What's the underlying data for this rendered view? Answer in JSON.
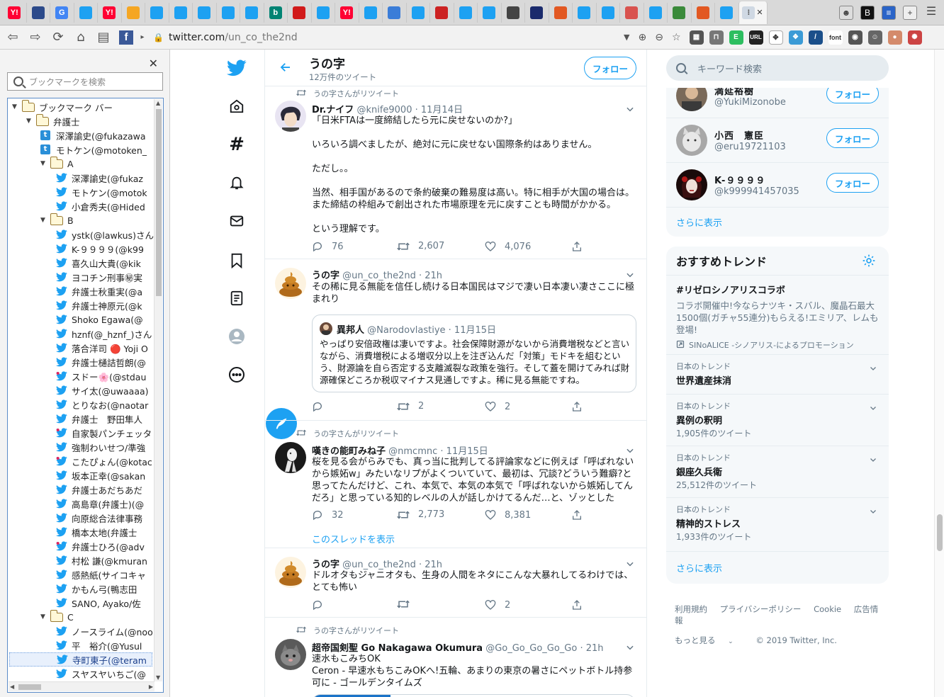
{
  "browser": {
    "tabs": [
      {
        "icon": "yahoo-icon",
        "label": "Y!",
        "color": "#ff0033"
      },
      {
        "icon": "photo-icon",
        "label": "",
        "color": "#2c4a8a"
      },
      {
        "icon": "google-news-icon",
        "label": "G",
        "color": "#4285f4"
      },
      {
        "icon": "twitter-icon",
        "label": "",
        "color": "#1da1f2"
      },
      {
        "icon": "yahoo-icon",
        "label": "Y!",
        "color": "#ff0033"
      },
      {
        "icon": "sun-icon",
        "label": "",
        "color": "#f5a623"
      },
      {
        "icon": "twitter-icon",
        "label": "",
        "color": "#1da1f2"
      },
      {
        "icon": "twitter-icon",
        "label": "",
        "color": "#1da1f2"
      },
      {
        "icon": "twitter-icon",
        "label": "",
        "color": "#1da1f2"
      },
      {
        "icon": "twitter-icon",
        "label": "",
        "color": "#1da1f2"
      },
      {
        "icon": "twitter-icon",
        "label": "",
        "color": "#1da1f2"
      },
      {
        "icon": "bing-icon",
        "label": "b",
        "color": "#008373"
      },
      {
        "icon": "red-drop-icon",
        "label": "",
        "color": "#d11a1a"
      },
      {
        "icon": "twitter-icon",
        "label": "",
        "color": "#1da1f2"
      },
      {
        "icon": "yahoo-icon",
        "label": "Y!",
        "color": "#ff0033"
      },
      {
        "icon": "twitter-icon",
        "label": "",
        "color": "#1da1f2"
      },
      {
        "icon": "globe-icon",
        "label": "",
        "color": "#3b7dd8"
      },
      {
        "icon": "twitter-icon",
        "label": "",
        "color": "#1da1f2"
      },
      {
        "icon": "flag-icon",
        "label": "",
        "color": "#cc2222"
      },
      {
        "icon": "twitter-icon",
        "label": "",
        "color": "#1da1f2"
      },
      {
        "icon": "twitter-icon",
        "label": "",
        "color": "#1da1f2"
      },
      {
        "icon": "people-icon",
        "label": "",
        "color": "#444444"
      },
      {
        "icon": "news-icon",
        "label": "",
        "color": "#1a2a6c"
      },
      {
        "icon": "fox-icon",
        "label": "",
        "color": "#e25822"
      },
      {
        "icon": "twitter-icon",
        "label": "",
        "color": "#1da1f2"
      },
      {
        "icon": "twitter-icon",
        "label": "",
        "color": "#1da1f2"
      },
      {
        "icon": "g-icon",
        "label": "",
        "color": "#d9534f"
      },
      {
        "icon": "twitter-icon",
        "label": "",
        "color": "#1da1f2"
      },
      {
        "icon": "frog-icon",
        "label": "",
        "color": "#3a8a3a"
      },
      {
        "icon": "fox-icon",
        "label": "",
        "color": "#e25822"
      },
      {
        "icon": "twitter-icon",
        "label": "",
        "color": "#1da1f2"
      }
    ],
    "active_tab_close": "✕",
    "url_host": "twitter.com",
    "url_path": "/un_co_the2nd"
  },
  "bookmarks": {
    "search_placeholder": "ブックマークを検索",
    "close": "✕",
    "items": [
      {
        "depth": 0,
        "type": "folder",
        "label": "ブックマーク バー"
      },
      {
        "depth": 1,
        "type": "folder",
        "label": "弁護士"
      },
      {
        "depth": 2,
        "type": "site",
        "label": "深澤諭史(@fukazawa"
      },
      {
        "depth": 2,
        "type": "site",
        "label": "モトケン(@motoken_"
      },
      {
        "depth": 2,
        "type": "folder",
        "label": "A"
      },
      {
        "depth": 3,
        "type": "twitter",
        "label": "深澤諭史(@fukaz"
      },
      {
        "depth": 3,
        "type": "twitter",
        "label": "モトケン(@motok"
      },
      {
        "depth": 3,
        "type": "twitter",
        "label": "小倉秀夫(@Hided"
      },
      {
        "depth": 2,
        "type": "folder",
        "label": "B"
      },
      {
        "depth": 3,
        "type": "twitter",
        "label": "ystk(@lawkus)さん"
      },
      {
        "depth": 3,
        "type": "twitter",
        "label": "K-９９９９(@k99"
      },
      {
        "depth": 3,
        "type": "twitter",
        "label": "喜久山大貴(@kik"
      },
      {
        "depth": 3,
        "type": "twitter",
        "label": "ヨコチン刑事㊙実"
      },
      {
        "depth": 3,
        "type": "twitter",
        "label": "弁護士秋重実(@a"
      },
      {
        "depth": 3,
        "type": "twitter",
        "label": "弁護士神原元(@k"
      },
      {
        "depth": 3,
        "type": "twitter",
        "label": "Shoko Egawa(@"
      },
      {
        "depth": 3,
        "type": "twitter",
        "label": "hznf(@_hznf_)さん"
      },
      {
        "depth": 3,
        "type": "twitter",
        "label": "落合洋司 🔴 Yoji O"
      },
      {
        "depth": 3,
        "type": "twitter",
        "label": "弁護士樋詰哲朗(@"
      },
      {
        "depth": 3,
        "type": "twitter-red",
        "label": "スドー🌸(@stdau"
      },
      {
        "depth": 3,
        "type": "twitter",
        "label": "サイ太(@uwaaaa)"
      },
      {
        "depth": 3,
        "type": "twitter",
        "label": "とりなお(@naotar"
      },
      {
        "depth": 3,
        "type": "twitter",
        "label": "弁護士　野田隼人"
      },
      {
        "depth": 3,
        "type": "twitter-red",
        "label": "自家製パンチェッタ"
      },
      {
        "depth": 3,
        "type": "twitter",
        "label": "強制わいせつ/準強"
      },
      {
        "depth": 3,
        "type": "twitter-red",
        "label": "こたぴょん(@kotac"
      },
      {
        "depth": 3,
        "type": "twitter",
        "label": "坂本正幸(@sakan"
      },
      {
        "depth": 3,
        "type": "twitter",
        "label": "弁護士あだちあだ"
      },
      {
        "depth": 3,
        "type": "twitter",
        "label": "高島章(弁護士)(@"
      },
      {
        "depth": 3,
        "type": "twitter",
        "label": "向原総合法律事務"
      },
      {
        "depth": 3,
        "type": "twitter",
        "label": "橋本太地(弁護士"
      },
      {
        "depth": 3,
        "type": "twitter-red",
        "label": "弁護士ひろ(@adv"
      },
      {
        "depth": 3,
        "type": "twitter",
        "label": "村松 謙(@kmuran"
      },
      {
        "depth": 3,
        "type": "twitter",
        "label": "感熱紙(サイコキャ"
      },
      {
        "depth": 3,
        "type": "twitter",
        "label": "かもん弓(鴨志田"
      },
      {
        "depth": 3,
        "type": "twitter",
        "label": "SANO, Ayako/佐"
      },
      {
        "depth": 2,
        "type": "folder",
        "label": "C"
      },
      {
        "depth": 3,
        "type": "twitter",
        "label": "ノースライム(@noo"
      },
      {
        "depth": 3,
        "type": "twitter",
        "label": "平　裕介(@Yusul"
      },
      {
        "depth": 3,
        "type": "twitter",
        "label": "寺町東子(@teram",
        "selected": true
      },
      {
        "depth": 3,
        "type": "twitter",
        "label": "スヤスヤいちご(@"
      }
    ]
  },
  "twitter": {
    "profile_name": "うの字",
    "tweet_count": "12万件のツイート",
    "follow_label": "フォロー",
    "search_placeholder": "キーワード検索",
    "tweets": [
      {
        "retweet_label": "うの字さんがリツイート",
        "name": "Dr.ナイフ",
        "handle": "@knife9000",
        "time": "11月14日",
        "body": "「日米FTAは一度締結したら元に戻せないのか?」\n\nいろいろ調べましたが、絶対に元に戻せない国際条約はありません。\n\nただし。。\n\n当然、相手国があるので条約破棄の難易度は高い。特に相手が大国の場合は。また締結の枠組みで創出された市場原理を元に戻すことも時間がかかる。\n\nという理解です。",
        "replies": "76",
        "retweets": "2,607",
        "likes": "4,076"
      },
      {
        "retweet_label": "",
        "name": "うの字",
        "handle": "@un_co_the2nd",
        "time": "21h",
        "body": "その稀に見る無能を信任し続ける日本国民はマジで凄い日本凄い凄さここに極まれり",
        "quote_name": "異邦人",
        "quote_handle": "@Narodovlastiye",
        "quote_time": "11月15日",
        "quote_body": "やっぱり安倍政権は凄いですよ。社会保障財源がないから消費増税などと言いながら、消費増税による増収分以上を注ぎ込んだ「対策」モドキを組むという、財源論を自ら否定する支離滅裂な政策を強行。そして蓋を開けてみれば財源確保どころか税収マイナス見通しですよ。稀に見る無能ですね。",
        "replies": "",
        "retweets": "2",
        "likes": "2"
      },
      {
        "retweet_label": "うの字さんがリツイート",
        "name": "嘆きの能町みね子",
        "handle": "@nmcmnc",
        "time": "11月15日",
        "body": "桜を見る会がらみでも、真っ当に批判してる評論家などに例えば「呼ばれないから嫉妬w」みたいなリプがよくついていて、最初は、冗談?どういう難癖?と思ってたんだけど、これ、本気で、本気の本気で「呼ばれないから嫉妬してんだろ」と思っている知的レベルの人が話しかけてるんだ…と、ゾッとした",
        "replies": "32",
        "retweets": "2,773",
        "likes": "8,381",
        "show_thread": "このスレッドを表示"
      },
      {
        "retweet_label": "",
        "name": "うの字",
        "handle": "@un_co_the2nd",
        "time": "21h",
        "body": "ドルオタもジャニオタも、生身の人間をネタにこんな大暴れしてるわけでは、とても怖い",
        "replies": "",
        "retweets": "",
        "likes": "2"
      },
      {
        "retweet_label": "うの字さんがリツイート",
        "name": "超帝国剣聖 Go Nakagawa Okumura",
        "handle": "@Go_Go_Go_Go_Go",
        "time": "21h",
        "body": "速水もこみちOK\nCeron - 早速水もちこみOKへ!五輪、あまりの東京の暑さにペットボトル持参可に - ゴールデンタイムズ",
        "replies": "",
        "retweets": "",
        "likes": ""
      }
    ],
    "who_to_follow": [
      {
        "name": "満延裕樹",
        "handle": "@YukiMizonobe"
      },
      {
        "name": "小西　憲臣",
        "handle": "@eru19721103"
      },
      {
        "name": "K-９９９９",
        "handle": "@k999941457035"
      }
    ],
    "show_more": "さらに表示",
    "trends_title": "おすすめトレンド",
    "promo": {
      "name": "#リゼロシノアリスコラボ",
      "desc": "コラボ開催中!今ならナツキ・スバル、魔晶石最大1500個(ガチャ55連分)もらえる!エミリア、レムも登場!",
      "by": "SINoALICE -シノアリス-によるプロモーション"
    },
    "trends": [
      {
        "category": "日本のトレンド",
        "name": "世界遺産抹消",
        "count": ""
      },
      {
        "category": "日本のトレンド",
        "name": "異例の釈明",
        "count": "1,905件のツイート"
      },
      {
        "category": "日本のトレンド",
        "name": "銀座久兵衛",
        "count": "25,512件のツイート"
      },
      {
        "category": "日本のトレンド",
        "name": "精神的ストレス",
        "count": "1,933件のツイート"
      }
    ],
    "footer": {
      "terms": "利用規約",
      "privacy": "プライバシーポリシー",
      "cookie": "Cookie",
      "ads": "広告情報",
      "more": "もっと見る",
      "copyright": "© 2019 Twitter, Inc."
    }
  }
}
